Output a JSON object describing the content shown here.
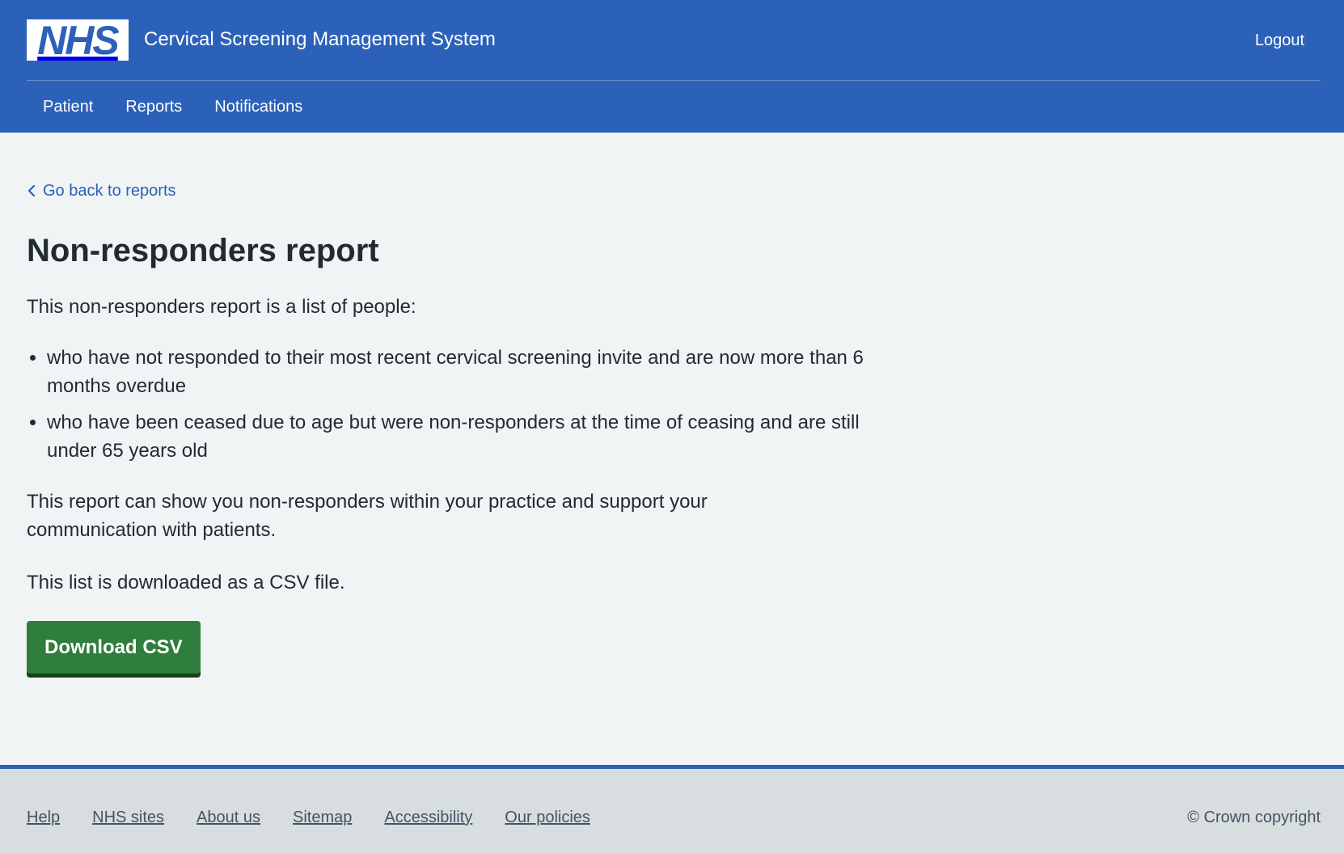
{
  "header": {
    "logo_text": "NHS",
    "service_name": "Cervical Screening Management System",
    "logout_label": "Logout",
    "nav": [
      {
        "label": "Patient"
      },
      {
        "label": "Reports"
      },
      {
        "label": "Notifications"
      }
    ]
  },
  "main": {
    "back_link": "Go back to reports",
    "title": "Non-responders report",
    "intro": "This non-responders report is a list of people:",
    "bullets": [
      "who have not responded to their most recent cervical screening invite and are now more than 6 months overdue",
      "who have been ceased due to age but were non-responders at the time of ceasing and are still under 65 years old"
    ],
    "paragraph_2": "This report can show you non-responders within your practice and support your communication with patients.",
    "paragraph_3": "This list is downloaded as a CSV file.",
    "download_button": "Download CSV"
  },
  "footer": {
    "links": [
      {
        "label": "Help"
      },
      {
        "label": "NHS sites"
      },
      {
        "label": "About us"
      },
      {
        "label": "Sitemap"
      },
      {
        "label": "Accessibility"
      },
      {
        "label": "Our policies"
      }
    ],
    "copyright": "© Crown copyright"
  },
  "colors": {
    "brand_blue": "#2c61b9",
    "button_green": "#2f7e3b",
    "page_background": "#f0f4f5",
    "footer_background": "#d8dde0",
    "text": "#212b32"
  },
  "icons": {
    "back": "chevron-left-icon"
  }
}
